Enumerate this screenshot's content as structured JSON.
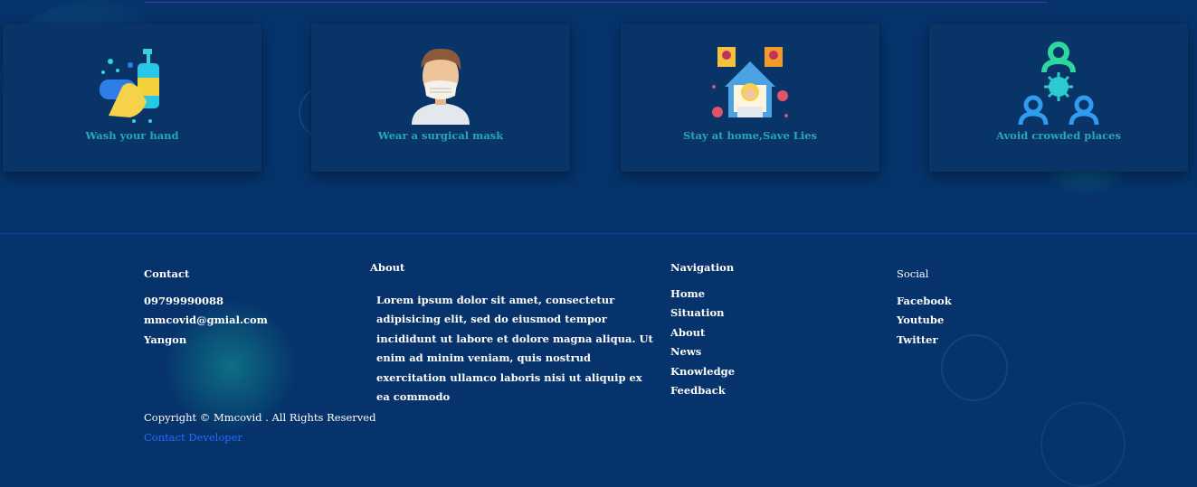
{
  "cards": [
    {
      "caption": "Wash your hand",
      "icon": "hand-wash-icon"
    },
    {
      "caption": "Wear a surgical mask",
      "icon": "masked-man-icon"
    },
    {
      "caption": "Stay at home,Save Lies",
      "icon": "stay-home-icon"
    },
    {
      "caption": "Avoid crowded places",
      "icon": "crowd-virus-icon"
    }
  ],
  "footer": {
    "contact": {
      "heading": "Contact",
      "phone": "09799990088",
      "email": "mmcovid@gmial.com",
      "city": "Yangon"
    },
    "about": {
      "heading": "About",
      "text": "Lorem ipsum dolor sit amet, consectetur adipisicing elit, sed do eiusmod tempor incididunt ut labore et dolore magna aliqua. Ut enim ad minim veniam, quis nostrud exercitation ullamco laboris nisi ut aliquip ex ea commodo"
    },
    "navigation": {
      "heading": "Navigation",
      "links": [
        "Home",
        "Situation",
        "About",
        "News",
        "Knowledge",
        "Feedback"
      ]
    },
    "social": {
      "heading": "Social",
      "links": [
        "Facebook",
        "Youtube",
        "Twitter"
      ]
    },
    "copyright": "Copyright © Mmcovid . All Rights Reserved",
    "contact_developer": "Contact Developer"
  },
  "colors": {
    "background": "#06336b",
    "card": "#093468",
    "caption": "#28a7b4",
    "link_accent": "#1e6fff"
  }
}
